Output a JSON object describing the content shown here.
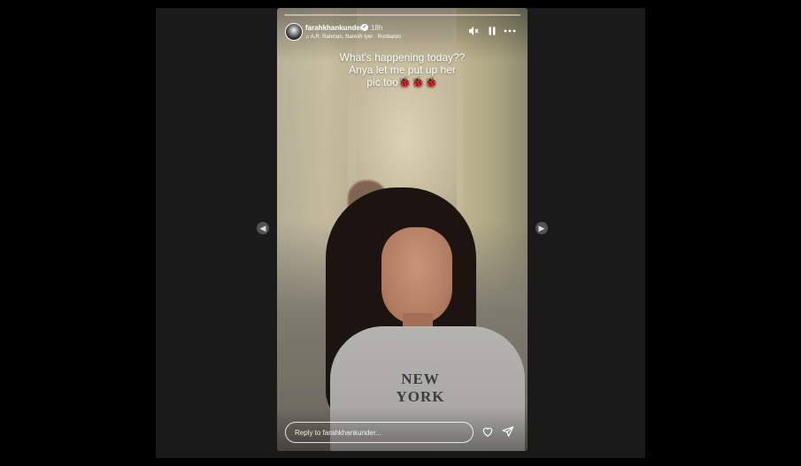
{
  "story": {
    "username": "farahkhankunder",
    "time_ago": "18h",
    "music": "A.R. Rahman, Naresh Iyer · Roobaroo",
    "caption_lines": [
      "What's happening today??",
      "Anya let me put up her",
      "pic too🐞🐞🐞"
    ],
    "progress": 0.0,
    "shirt_text": "NEW YORK"
  },
  "controls": {
    "mute_icon": "speaker-muted-icon",
    "pause_icon": "pause-icon",
    "more_icon": "more-horizontal-icon"
  },
  "reply": {
    "placeholder": "Reply to farahkhankunder..."
  },
  "nav": {
    "prev_icon": "chevron-left-icon",
    "next_icon": "chevron-right-icon"
  }
}
